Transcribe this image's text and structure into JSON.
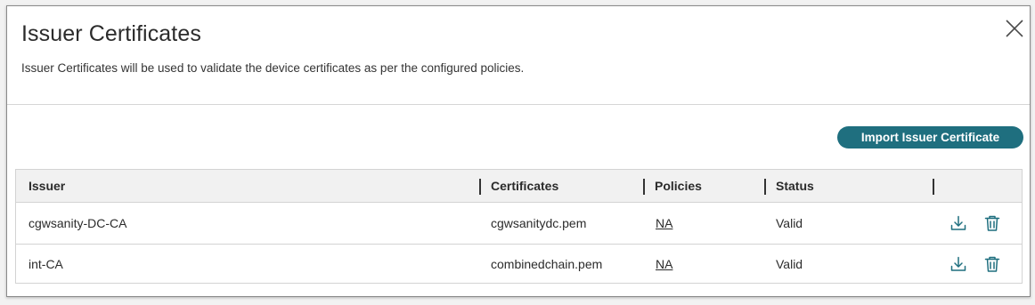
{
  "dialog": {
    "title": "Issuer Certificates",
    "description": "Issuer Certificates will be used to validate the device certificates as per the configured policies.",
    "close_icon": "close-icon"
  },
  "toolbar": {
    "import_label": "Import Issuer Certificate",
    "accent_color": "#1f6f7f"
  },
  "table": {
    "columns": [
      "Issuer",
      "Certificates",
      "Policies",
      "Status"
    ],
    "rows": [
      {
        "issuer": "cgwsanity-DC-CA",
        "certificate": "cgwsanitydc.pem",
        "policies": "NA",
        "status": "Valid",
        "actions": [
          "download-icon",
          "trash-icon"
        ]
      },
      {
        "issuer": "int-CA",
        "certificate": "combinedchain.pem",
        "policies": "NA",
        "status": "Valid",
        "actions": [
          "download-icon",
          "trash-icon"
        ]
      }
    ]
  }
}
